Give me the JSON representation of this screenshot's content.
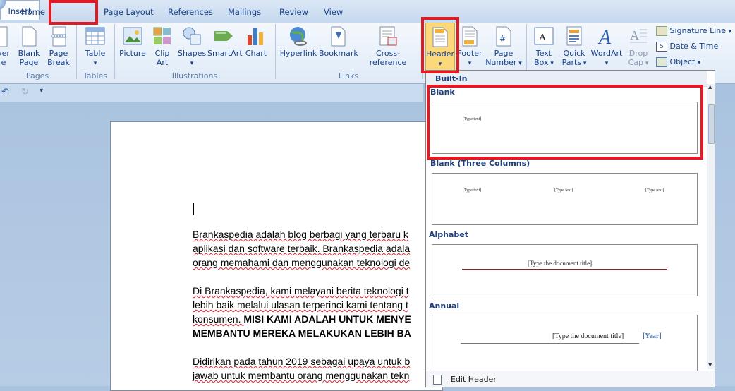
{
  "tabs": {
    "home": "Home",
    "insert": "Insert",
    "page_layout": "Page Layout",
    "references": "References",
    "mailings": "Mailings",
    "review": "Review",
    "view": "View"
  },
  "ribbon": {
    "pages": {
      "cover_line1": "ver",
      "cover_line2": "e",
      "blank_line1": "Blank",
      "blank_line2": "Page",
      "break_line1": "Page",
      "break_line2": "Break",
      "group": "Pages"
    },
    "tables": {
      "table": "Table",
      "group": "Tables"
    },
    "illustrations": {
      "picture": "Picture",
      "clip_line1": "Clip",
      "clip_line2": "Art",
      "shapes": "Shapes",
      "smartart": "SmartArt",
      "chart": "Chart",
      "group": "Illustrations"
    },
    "links": {
      "hyperlink": "Hyperlink",
      "bookmark": "Bookmark",
      "crossref": "Cross-reference",
      "group": "Links"
    },
    "header_footer": {
      "header": "Header",
      "footer": "Footer",
      "page_number_line1": "Page",
      "page_number_line2": "Number"
    },
    "text": {
      "textbox_line1": "Text",
      "textbox_line2": "Box",
      "quickparts_line1": "Quick",
      "quickparts_line2": "Parts",
      "wordart": "WordArt",
      "dropcap_line1": "Drop",
      "dropcap_line2": "Cap",
      "signature": "Signature Line",
      "datetime": "Date & Time",
      "object": "Object"
    }
  },
  "document": {
    "p1": [
      "Brankaspedia adalah blog berbagi yang terbaru k",
      "aplikasi dan software terbaik. Brankaspedia  adala",
      "orang memahami dan menggunakan teknologi de"
    ],
    "p2": [
      "Di Brankaspedia,  kami melayani berita teknologi t",
      "lebih baik melalui  ulasan terperinci kami tentang t"
    ],
    "p2_last_normal": "konsumen. ",
    "p2_last_bold": "MISI KAMI ADALAH UNTUK MENYE",
    "p2_bold_line": "MEMBANTU MEREKA MELAKUKAN LEBIH BA",
    "p3": [
      "Didirikan pada tahun 2019 sebagai  upaya untuk b",
      "jawab untuk membantu orang menggunakan  tekn"
    ]
  },
  "gallery": {
    "section": "Built-In",
    "items": [
      {
        "label": "Blank",
        "texts": [
          "[Type text]"
        ]
      },
      {
        "label": "Blank (Three Columns)",
        "texts": [
          "[Type text]",
          "[Type text]",
          "[Type text]"
        ]
      },
      {
        "label": "Alphabet",
        "texts": [
          "[Type the document title]"
        ]
      },
      {
        "label": "Annual",
        "texts": [
          "[Type the document title]",
          "[Year]"
        ]
      }
    ],
    "footer": "Edit Header"
  }
}
